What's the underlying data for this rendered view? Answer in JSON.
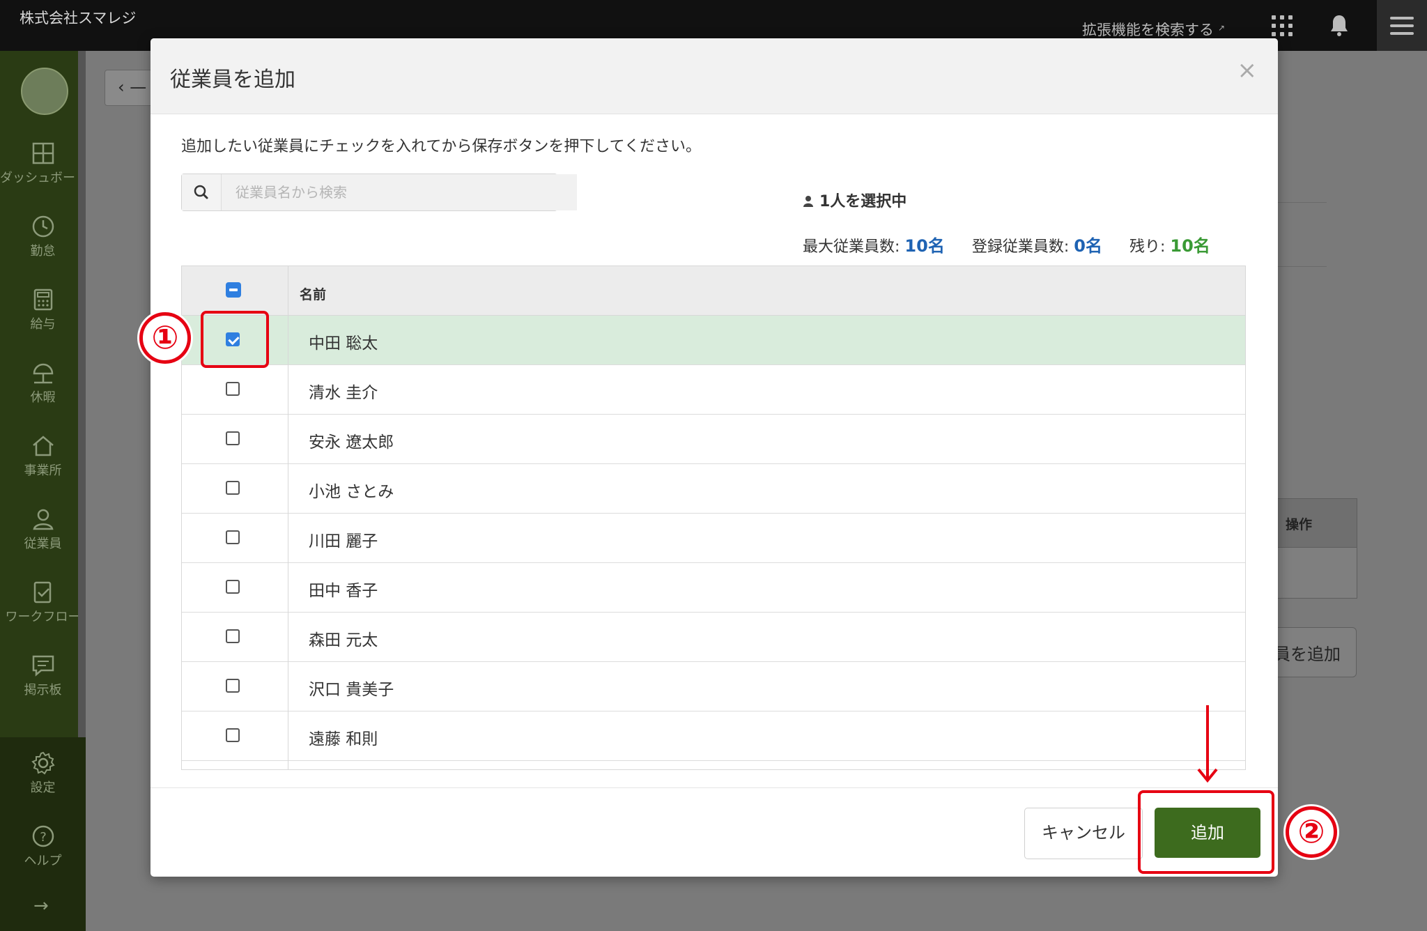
{
  "topbar": {
    "company": "株式会社スマレジ",
    "extension_search": "拡張機能を検索する"
  },
  "sidebar": {
    "items": [
      {
        "label": "ダッシュボード",
        "icon": "dashboard-icon"
      },
      {
        "label": "勤怠",
        "icon": "clock-icon"
      },
      {
        "label": "給与",
        "icon": "calculator-icon"
      },
      {
        "label": "休暇",
        "icon": "umbrella-icon"
      },
      {
        "label": "事業所",
        "icon": "home-icon"
      },
      {
        "label": "従業員",
        "icon": "person-icon"
      },
      {
        "label": "ワークフロー",
        "icon": "workflow-icon"
      },
      {
        "label": "掲示板",
        "icon": "message-icon"
      }
    ],
    "bottom_items": [
      {
        "label": "設定",
        "icon": "gear-icon"
      },
      {
        "label": "ヘルプ",
        "icon": "help-icon"
      }
    ]
  },
  "background": {
    "table_header": "操作",
    "add_button": "員を追加"
  },
  "modal": {
    "title": "従業員を追加",
    "instruction": "追加したい従業員にチェックを入れてから保存ボタンを押下してください。",
    "search_placeholder": "従業員名から検索",
    "selected_count": "1人を選択中",
    "stats": {
      "max_label": "最大従業員数:",
      "max_value": "10名",
      "registered_label": "登録従業員数:",
      "registered_value": "0名",
      "remaining_label": "残り:",
      "remaining_value": "10名"
    },
    "table": {
      "name_header": "名前",
      "rows": [
        {
          "name": "中田 聡太",
          "checked": true
        },
        {
          "name": "清水 圭介",
          "checked": false
        },
        {
          "name": "安永 遼太郎",
          "checked": false
        },
        {
          "name": "小池 さとみ",
          "checked": false
        },
        {
          "name": "川田 麗子",
          "checked": false
        },
        {
          "name": "田中 香子",
          "checked": false
        },
        {
          "name": "森田 元太",
          "checked": false
        },
        {
          "name": "沢口 貴美子",
          "checked": false
        },
        {
          "name": "遠藤 和則",
          "checked": false
        }
      ]
    },
    "cancel_label": "キャンセル",
    "add_label": "追加"
  },
  "annotations": {
    "step1": "①",
    "step2": "②"
  },
  "colors": {
    "sidebar": "#2a3b14",
    "primary_button": "#3d6b1e",
    "annotation": "#e60012",
    "checkbox": "#2f7fe0",
    "selected_row": "#d9ecdc"
  }
}
